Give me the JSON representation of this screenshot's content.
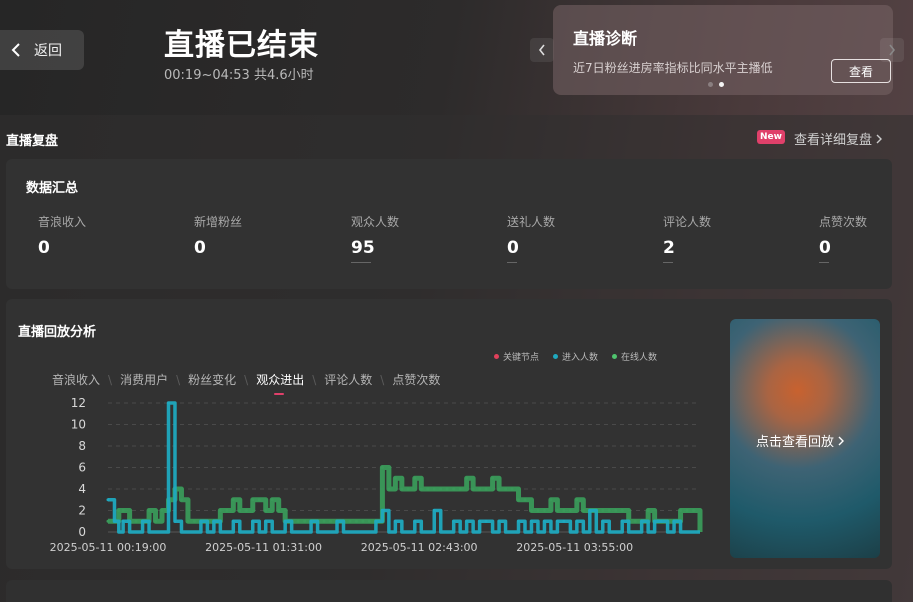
{
  "header": {
    "back_label": "返回",
    "title": "直播已结束",
    "subtitle": "00:19~04:53 共4.6小时"
  },
  "diagnosis": {
    "title": "直播诊断",
    "desc": "近7日粉丝进房率指标比同水平主播低",
    "button": "查看"
  },
  "review": {
    "section_title": "直播复盘",
    "new_badge": "New",
    "detail_link": "查看详细复盘"
  },
  "summary": {
    "title": "数据汇总",
    "stats": [
      {
        "label": "音浪收入",
        "value": "0"
      },
      {
        "label": "新增粉丝",
        "value": "0"
      },
      {
        "label": "观众人数",
        "value": "95"
      },
      {
        "label": "送礼人数",
        "value": "0"
      },
      {
        "label": "评论人数",
        "value": "2"
      },
      {
        "label": "点赞次数",
        "value": "0"
      }
    ]
  },
  "analysis": {
    "title": "直播回放分析",
    "tabs": [
      "音浪收入",
      "消费用户",
      "粉丝变化",
      "观众进出",
      "评论人数",
      "点赞次数"
    ],
    "active_tab": 3,
    "replay_label": "点击查看回放"
  },
  "colors": {
    "key_node": "#e0405a",
    "enter": "#1fa9bf",
    "online": "#3a9a5a",
    "accent": "#e0406a"
  },
  "chart_data": {
    "type": "line",
    "x_range": [
      "2025-05-11 00:19:00",
      "2025-05-11 04:53:00"
    ],
    "xtick_labels": [
      "2025-05-11 00:19:00",
      "2025-05-11 01:31:00",
      "2025-05-11 02:43:00",
      "2025-05-11 03:55:00"
    ],
    "ylim": [
      0,
      12
    ],
    "yticks": [
      0,
      2,
      4,
      6,
      8,
      10,
      12
    ],
    "legend": [
      "关键节点",
      "进入人数",
      "在线人数"
    ],
    "series": [
      {
        "name": "在线人数",
        "x": [
          "00:19",
          "00:22",
          "00:24",
          "00:26",
          "00:29",
          "00:32",
          "00:35",
          "00:38",
          "00:41",
          "00:44",
          "00:47",
          "00:50",
          "00:53",
          "00:56",
          "00:59",
          "01:02",
          "01:05",
          "01:08",
          "01:11",
          "01:14",
          "01:17",
          "01:20",
          "01:23",
          "01:26",
          "01:29",
          "01:32",
          "01:35",
          "01:38",
          "01:41",
          "01:44",
          "01:47",
          "01:50",
          "01:53",
          "01:56",
          "01:59",
          "02:02",
          "02:05",
          "02:08",
          "02:11",
          "02:14",
          "02:17",
          "02:20",
          "02:23",
          "02:26",
          "02:29",
          "02:32",
          "02:35",
          "02:38",
          "02:41",
          "02:44",
          "02:47",
          "02:50",
          "02:53",
          "02:56",
          "02:59",
          "03:02",
          "03:05",
          "03:08",
          "03:11",
          "03:14",
          "03:17",
          "03:20",
          "03:23",
          "03:26",
          "03:29",
          "03:32",
          "03:35",
          "03:38",
          "03:41",
          "03:44",
          "03:47",
          "03:50",
          "03:53",
          "03:56",
          "03:59",
          "04:02",
          "04:05",
          "04:08",
          "04:11",
          "04:14",
          "04:17",
          "04:20",
          "04:23",
          "04:26",
          "04:29",
          "04:32",
          "04:35",
          "04:38",
          "04:41",
          "04:44",
          "04:47",
          "04:50",
          "04:53"
        ],
        "values": [
          1,
          1,
          2,
          2,
          1,
          1,
          1,
          2,
          1,
          2,
          3,
          4,
          3,
          1,
          1,
          1,
          1,
          1,
          2,
          2,
          3,
          2,
          2,
          3,
          3,
          2,
          3,
          2,
          1,
          1,
          1,
          1,
          1,
          1,
          1,
          1,
          1,
          1,
          1,
          1,
          1,
          1,
          1,
          6,
          4,
          5,
          4,
          4,
          5,
          4,
          4,
          4,
          4,
          4,
          4,
          4,
          5,
          4,
          4,
          4,
          5,
          4,
          4,
          4,
          3,
          3,
          2,
          2,
          2,
          3,
          2,
          2,
          2,
          3,
          2,
          2,
          2,
          2,
          2,
          2,
          2,
          1,
          1,
          1,
          2,
          1,
          1,
          1,
          1,
          2,
          2,
          2,
          0
        ]
      },
      {
        "name": "进入人数",
        "x": [
          "00:19",
          "00:22",
          "00:24",
          "00:26",
          "00:29",
          "00:32",
          "00:35",
          "00:38",
          "00:41",
          "00:44",
          "00:47",
          "00:50",
          "00:53",
          "00:56",
          "00:59",
          "01:02",
          "01:05",
          "01:08",
          "01:11",
          "01:14",
          "01:17",
          "01:20",
          "01:23",
          "01:26",
          "01:29",
          "01:32",
          "01:35",
          "01:38",
          "01:41",
          "01:44",
          "01:47",
          "01:50",
          "01:53",
          "01:56",
          "01:59",
          "02:02",
          "02:05",
          "02:08",
          "02:11",
          "02:14",
          "02:17",
          "02:20",
          "02:23",
          "02:26",
          "02:29",
          "02:32",
          "02:35",
          "02:38",
          "02:41",
          "02:44",
          "02:47",
          "02:50",
          "02:53",
          "02:56",
          "02:59",
          "03:02",
          "03:05",
          "03:08",
          "03:11",
          "03:14",
          "03:17",
          "03:20",
          "03:23",
          "03:26",
          "03:29",
          "03:32",
          "03:35",
          "03:38",
          "03:41",
          "03:44",
          "03:47",
          "03:50",
          "03:53",
          "03:56",
          "03:59",
          "04:02",
          "04:05",
          "04:08",
          "04:11",
          "04:14",
          "04:17",
          "04:20",
          "04:23",
          "04:26",
          "04:29",
          "04:32",
          "04:35",
          "04:38",
          "04:41",
          "04:44",
          "04:47",
          "04:50",
          "04:53"
        ],
        "values": [
          3,
          1,
          0,
          1,
          0,
          0,
          1,
          0,
          0,
          0,
          12,
          1,
          0,
          0,
          0,
          1,
          0,
          1,
          0,
          0,
          1,
          0,
          0,
          1,
          0,
          1,
          0,
          0,
          1,
          0,
          0,
          0,
          1,
          0,
          0,
          0,
          1,
          0,
          0,
          0,
          0,
          0,
          1,
          2,
          0,
          1,
          0,
          0,
          1,
          0,
          0,
          2,
          0,
          0,
          1,
          0,
          1,
          0,
          1,
          1,
          0,
          1,
          0,
          0,
          1,
          0,
          1,
          0,
          1,
          0,
          1,
          1,
          0,
          1,
          0,
          2,
          0,
          1,
          0,
          0,
          1,
          0,
          0,
          1,
          0,
          1,
          1,
          0,
          1,
          0,
          0,
          0,
          0
        ]
      }
    ]
  }
}
